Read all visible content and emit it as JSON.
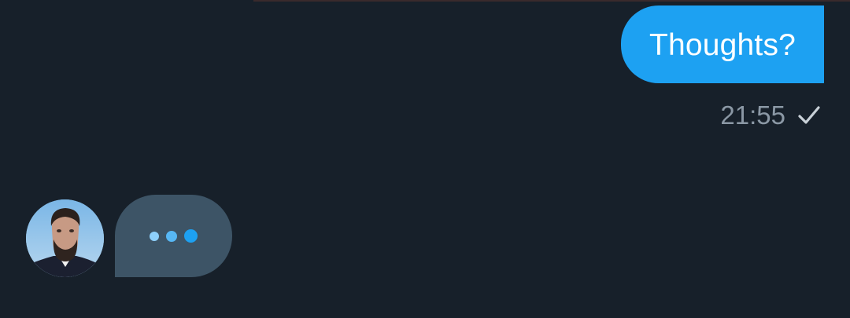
{
  "colors": {
    "background": "#17202a",
    "outgoing_bubble": "#1da1f2",
    "typing_bubble": "#3d5466",
    "meta_text": "#8b98a5"
  },
  "conversation": {
    "outgoing_message": {
      "text": "Thoughts?",
      "time": "21:55",
      "status_icon": "check-icon"
    },
    "incoming_typing": {
      "avatar_icon": "user-avatar-photo",
      "indicator_icon": "typing-dots-icon"
    }
  }
}
